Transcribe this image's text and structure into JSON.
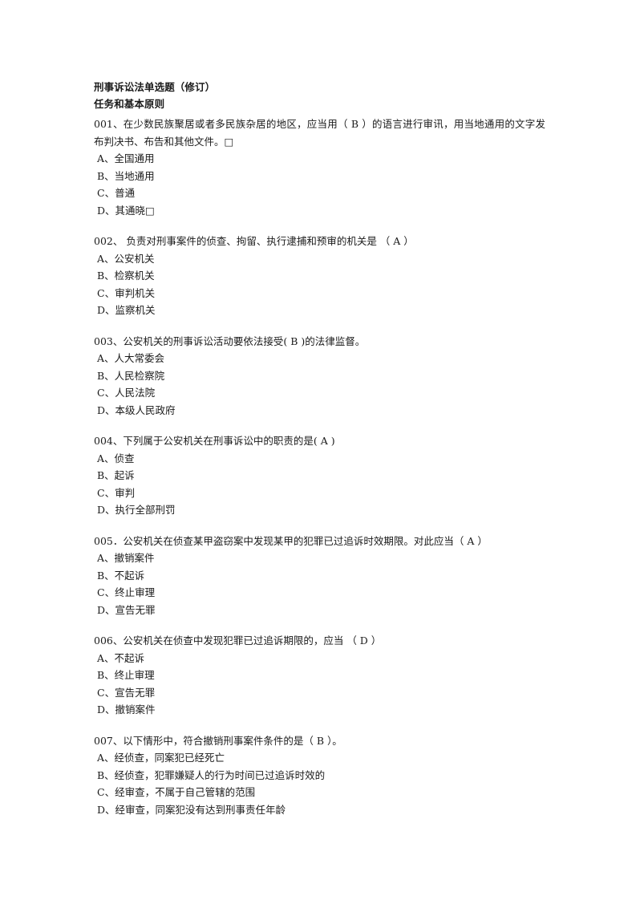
{
  "document": {
    "title": "刑事诉讼法单选题（修订）",
    "subtitle": "任务和基本原则"
  },
  "questions": [
    {
      "stem": "001、在少数民族聚居或者多民族杂居的地区，应当用（ B ）的语言进行审讯，用当地通用的文字发布判决书、布告和其他文件。□",
      "options": [
        "A、全国通用",
        "B、当地通用",
        "C、普通",
        "D、其通晓□"
      ]
    },
    {
      "stem": "002、 负责对刑事案件的侦查、拘留、执行逮捕和预审的机关是 （ A ）",
      "options": [
        "A、公安机关",
        "B、检察机关",
        "C、审判机关",
        "D、监察机关"
      ]
    },
    {
      "stem": "003、公安机关的刑事诉讼活动要依法接受( B )的法律监督。",
      "options": [
        "A、人大常委会",
        "B、人民检察院",
        "C、人民法院",
        "D、本级人民政府"
      ]
    },
    {
      "stem": "004、下列属于公安机关在刑事诉讼中的职责的是( A )",
      "options": [
        "A、侦查",
        "B、起诉",
        "C、审判",
        "D、执行全部刑罚"
      ]
    },
    {
      "stem": "005．公安机关在侦查某甲盗窃案中发现某甲的犯罪已过追诉时效期限。对此应当（ A ）",
      "options": [
        "A、撤销案件",
        "B、不起诉",
        "C、终止审理",
        "D、宣告无罪"
      ]
    },
    {
      "stem": "006、公安机关在侦查中发现犯罪已过追诉期限的，应当 （ D ）",
      "options": [
        "A、不起诉",
        "B、终止审理",
        "C、宣告无罪",
        "D、撤销案件"
      ]
    },
    {
      "stem": "007、以下情形中，符合撤销刑事案件条件的是（ B ）。",
      "options": [
        "A、经侦查，同案犯已经死亡",
        "B、经侦查，犯罪嫌疑人的行为时间已过追诉时效的",
        "C、经审查，不属于自己管辖的范围",
        "D、经审查，同案犯没有达到刑事责任年龄"
      ]
    }
  ]
}
